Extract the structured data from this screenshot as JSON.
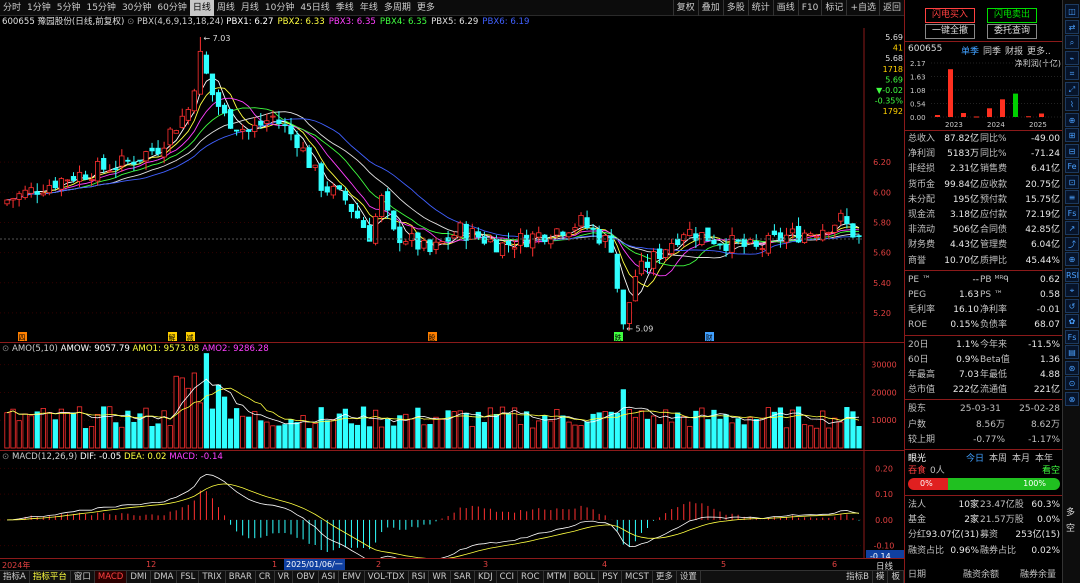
{
  "toolbar": {
    "periods": [
      "分时",
      "1分钟",
      "5分钟",
      "15分钟",
      "30分钟",
      "60分钟",
      "日线",
      "周线",
      "月线",
      "10分钟",
      "45日线",
      "季线",
      "年线",
      "多周期",
      "更多"
    ],
    "active": "日线",
    "actions": [
      "复权",
      "叠加",
      "多股",
      "统计",
      "画线",
      "F10",
      "标记",
      "+自选",
      "返回"
    ]
  },
  "main_chart": {
    "stock_label": "600655 豫园股份(日线,前复权)",
    "pbx_params": "PBX(4,6,9,13,18,24)",
    "pbx": [
      {
        "name": "PBX1",
        "value": "6.27",
        "color": "#ffffff"
      },
      {
        "name": "PBX2",
        "value": "6.33",
        "color": "#ffff40"
      },
      {
        "name": "PBX3",
        "value": "6.35",
        "color": "#ff40ff"
      },
      {
        "name": "PBX4",
        "value": "6.35",
        "color": "#40ff40"
      },
      {
        "name": "PBX5",
        "value": "6.29",
        "color": "#e0e0e0"
      },
      {
        "name": "PBX6",
        "value": "6.19",
        "color": "#4060ff"
      }
    ],
    "high_label": "7.03",
    "low_label": "5.09",
    "y_ticks": [
      "6.20",
      "6.00",
      "5.80",
      "5.60",
      "5.40",
      "5.20"
    ],
    "right_info": [
      "5.69",
      "41",
      "5.68",
      "1718",
      "5.69",
      "▼-0.02",
      "-0.35%",
      "1792"
    ],
    "markers": [
      {
        "t": "四",
        "x": 22,
        "c": "#ff8000"
      },
      {
        "t": "解",
        "x": 172,
        "c": "#ffd000"
      },
      {
        "t": "减",
        "x": 190,
        "c": "#ffd000"
      },
      {
        "t": "股",
        "x": 432,
        "c": "#ff8000"
      },
      {
        "t": "跌",
        "x": 618,
        "c": "#40ff40"
      },
      {
        "t": "财",
        "x": 709,
        "c": "#40a0ff"
      }
    ]
  },
  "volume_panel": {
    "label": "AMO(5,10)",
    "amow": "AMOW: 9057.79",
    "amo1": "AMO1: 9573.08",
    "amo2": "AMO2: 9286.28",
    "y_ticks": [
      "30000",
      "20000",
      "10000"
    ]
  },
  "macd_panel": {
    "label": "MACD(12,26,9)",
    "dif": "DIF: -0.05",
    "dea": "DEA: 0.02",
    "macd": "MACD: -0.14",
    "y_ticks": [
      "0.20",
      "0.10",
      "0.00",
      "-0.10"
    ],
    "current": "-0.14"
  },
  "x_axis": {
    "labels": [
      {
        "t": "2024年",
        "x": 2
      },
      {
        "t": "12",
        "x": 146
      },
      {
        "t": "1",
        "x": 272
      },
      {
        "t": "2",
        "x": 376
      },
      {
        "t": "3",
        "x": 483
      },
      {
        "t": "4",
        "x": 602
      },
      {
        "t": "5",
        "x": 721
      },
      {
        "t": "6",
        "x": 832
      }
    ],
    "cursor_date": "2025/01/06/一",
    "right_label": "日线"
  },
  "bottom_tabs": [
    "指标A",
    "指标平台",
    "窗口",
    "MACD",
    "DMI",
    "DMA",
    "FSL",
    "TRIX",
    "BRAR",
    "CR",
    "VR",
    "OBV",
    "ASI",
    "EMV",
    "VOL-TDX",
    "RSI",
    "WR",
    "SAR",
    "KDJ",
    "CCI",
    "ROC",
    "MTM",
    "BOLL",
    "PSY",
    "MCST",
    "更多",
    "设置"
  ],
  "bottom_right_tabs": [
    "指标B",
    "模",
    "板"
  ],
  "right_panel": {
    "buy_btn": "闪电买入",
    "sell_btn": "闪电卖出",
    "clear_btn": "一键全撤",
    "order_btn": "委托查询",
    "code": "600655",
    "tabs": [
      "单季",
      "同季",
      "财报",
      "更多.."
    ],
    "chart_title": "净利润(十亿)",
    "bar_y": [
      "2.17",
      "1.63",
      "1.08",
      "0.54",
      "0.00"
    ],
    "bar_years": [
      "2023",
      "2024",
      "2025"
    ],
    "bars": [
      {
        "v": 0.08,
        "c": "#ff3020"
      },
      {
        "v": 1.92,
        "c": "#ff3020"
      },
      {
        "v": 0.16,
        "c": "#ff3020"
      },
      {
        "v": 0.02,
        "c": "#ff3020"
      },
      {
        "v": 0.35,
        "c": "#ff3020"
      },
      {
        "v": 0.71,
        "c": "#ff3020"
      },
      {
        "v": 0.94,
        "c": "#00d000"
      },
      {
        "v": 0.03,
        "c": "#ff3020"
      },
      {
        "v": 0.14,
        "c": "#ff3020"
      }
    ],
    "fin": [
      [
        "总收入",
        "87.82亿",
        "同比%",
        "-49.00"
      ],
      [
        "净利润",
        "5183万",
        "同比%",
        "-71.24"
      ],
      [
        "非经损",
        "2.31亿",
        "销售费",
        "6.41亿"
      ],
      [
        "货币金",
        "99.84亿",
        "应收款",
        "20.75亿"
      ],
      [
        "未分配",
        "195亿",
        "预付款",
        "15.75亿"
      ],
      [
        "现金流",
        "3.18亿",
        "应付款",
        "72.19亿"
      ],
      [
        "非流动",
        "506亿",
        "合同债",
        "42.85亿"
      ],
      [
        "财务费",
        "4.43亿",
        "管理费",
        "6.04亿"
      ],
      [
        "商誉",
        "10.70亿",
        "质押比",
        "45.44%"
      ]
    ],
    "val": [
      [
        "PE ™",
        "--",
        "PB ᴹᴿᑫ",
        "0.62"
      ],
      [
        "PEG",
        "1.63",
        "PS ™",
        "0.58"
      ],
      [
        "毛利率",
        "16.10",
        "净利率",
        "-0.01"
      ],
      [
        "ROE",
        "0.15%",
        "负债率",
        "68.07"
      ]
    ],
    "perf": [
      [
        "20日",
        "1.1%",
        "今年来",
        "-11.5%"
      ],
      [
        "60日",
        "0.9%",
        "Beta值",
        "1.36"
      ],
      [
        "年最高",
        "7.03",
        "年最低",
        "4.88"
      ],
      [
        "总市值",
        "222亿",
        "流通值",
        "221亿"
      ]
    ],
    "holders": {
      "label": "股东",
      "d1": "25-03-31",
      "d2": "25-02-28",
      "r1": [
        "户数",
        "8.56万",
        "8.62万"
      ],
      "r2": [
        "较上期",
        "-0.77%",
        "-1.17%"
      ]
    },
    "eyes": {
      "title": "眼光",
      "tabs": [
        "今日",
        "本周",
        "本月",
        "本年"
      ],
      "chg": "吞食",
      "count": "0人",
      "rise": "看空",
      "p0": "0%",
      "p100": "100%"
    },
    "inst": [
      [
        "法人",
        "10家",
        "23.47亿股",
        "60.3%"
      ],
      [
        "基金",
        "2家",
        "21.57万股",
        "0.0%"
      ],
      [
        "分红",
        "93.07亿(31)",
        "募资",
        "253亿(15)"
      ],
      [
        "融资占比",
        "0.96%",
        "融券占比",
        "0.02%"
      ]
    ],
    "foot": [
      "日期",
      "融资余额",
      "融券余量"
    ]
  }
}
